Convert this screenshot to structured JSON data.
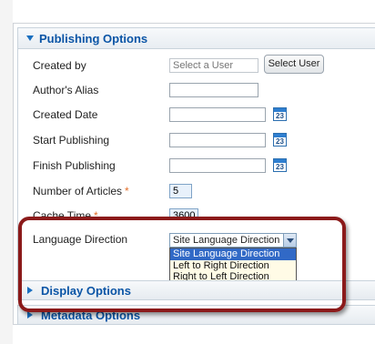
{
  "panel": {
    "title": "Publishing Options"
  },
  "fields": {
    "created_by": {
      "label": "Created by",
      "placeholder": "Select a User",
      "button": "Select User"
    },
    "authors_alias": {
      "label": "Author's Alias",
      "value": ""
    },
    "created_date": {
      "label": "Created Date",
      "value": ""
    },
    "start_publishing": {
      "label": "Start Publishing",
      "value": ""
    },
    "finish_publishing": {
      "label": "Finish Publishing",
      "value": ""
    },
    "number_of_articles": {
      "label": "Number of Articles",
      "required": "*",
      "value": "5"
    },
    "cache_time": {
      "label": "Cache Time",
      "required": "*",
      "value": "3600"
    },
    "language_direction": {
      "label": "Language Direction",
      "selected": "Site Language Direction",
      "options": [
        "Site Language Direction",
        "Left to Right Direction",
        "Right to Left Direction"
      ]
    }
  },
  "calendar_icon_text": "23",
  "sections": {
    "display_options": "Display Options",
    "metadata_options": "Metadata Options"
  },
  "icons": {
    "panel_toggle": "triangle-down-icon",
    "section_toggle": "triangle-right-icon",
    "calendar": "calendar-icon"
  },
  "colors": {
    "header_text": "#0b55a6",
    "required_mark": "#e4702b",
    "highlight_border": "#8b1a1a",
    "selected_option": "#3169c6"
  }
}
